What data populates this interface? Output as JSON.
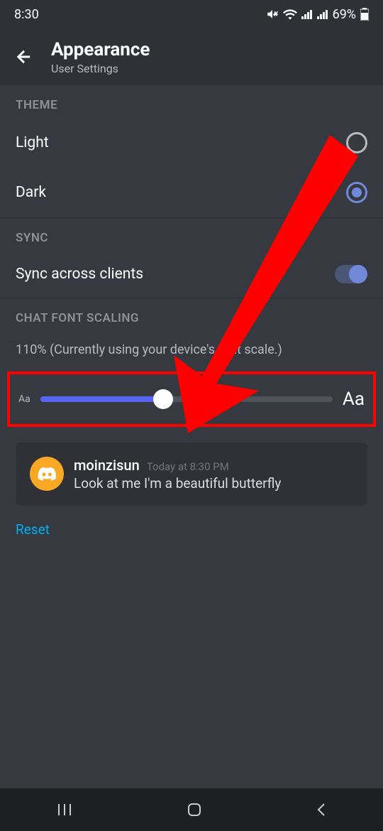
{
  "status_bar": {
    "time": "8:30",
    "battery": "69%"
  },
  "header": {
    "title": "Appearance",
    "subtitle": "User Settings"
  },
  "theme": {
    "section_label": "THEME",
    "light_label": "Light",
    "dark_label": "Dark",
    "selected": "dark"
  },
  "sync": {
    "section_label": "SYNC",
    "label": "Sync across clients",
    "enabled": true
  },
  "font_scaling": {
    "section_label": "CHAT FONT SCALING",
    "status_text": "110% (Currently using your device's font scale.)",
    "small_indicator": "Aa",
    "large_indicator": "Aa",
    "slider_percent": 42
  },
  "message_preview": {
    "username": "moinzisun",
    "timestamp": "Today at 8:30 PM",
    "body": "Look at me I'm a beautiful butterfly"
  },
  "reset_label": "Reset",
  "annotation": {
    "type": "arrow",
    "color": "#ff0000",
    "highlight_box": "slider"
  }
}
